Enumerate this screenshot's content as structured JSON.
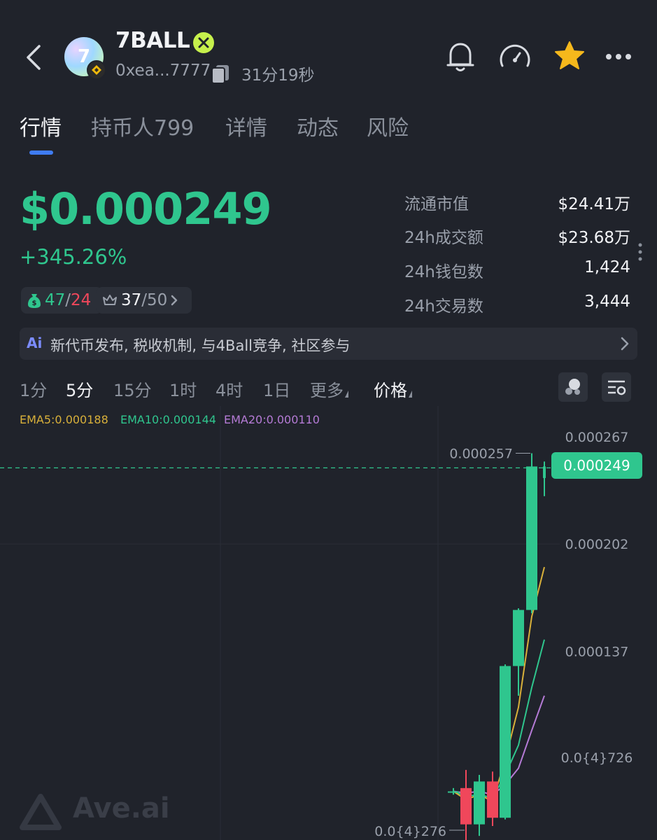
{
  "header": {
    "avatar_letter": "7",
    "token_name": "7BALL",
    "address": "0xea...7777",
    "age": "31分19秒"
  },
  "tabs": [
    {
      "label": "行情"
    },
    {
      "label": "持币人799"
    },
    {
      "label": "详情"
    },
    {
      "label": "动态"
    },
    {
      "label": "风险"
    }
  ],
  "price": {
    "value": "$0.000249",
    "change": "+345.26%"
  },
  "chips": {
    "buys": "47",
    "sep": "/",
    "sells": "24",
    "holders_a": "37",
    "holders_b": "/50"
  },
  "stats": [
    {
      "label": "流通市值",
      "value": "$24.41万"
    },
    {
      "label": "24h成交额",
      "value": "$23.68万"
    },
    {
      "label": "24h钱包数",
      "value": "1,424"
    },
    {
      "label": "24h交易数",
      "value": "3,444"
    }
  ],
  "ai_banner": {
    "icon": "Ai",
    "text": "新代币发布, 税收机制, 与4Ball竞争, 社区参与"
  },
  "timeframes": [
    {
      "label": "1分"
    },
    {
      "label": "5分"
    },
    {
      "label": "15分"
    },
    {
      "label": "1时"
    },
    {
      "label": "4时"
    },
    {
      "label": "1日"
    },
    {
      "label": "更多"
    },
    {
      "label": "价格"
    }
  ],
  "ema": {
    "ema5": "EMA5:0.000188",
    "ema10": "EMA10:0.000144",
    "ema20": "EMA20:0.000110"
  },
  "colors": {
    "up": "#2fc68e",
    "down": "#f0475b",
    "ema5": "#d8b03a",
    "ema10": "#2fc68e",
    "ema20": "#b57bd6"
  },
  "chart_data": {
    "type": "candlestick",
    "y_axis_labels": [
      "0.000267",
      "0.000202",
      "0.000137",
      "0.0{4}726"
    ],
    "high_label": "0.000257",
    "low_label": "0.0{4}276",
    "current_price_label": "0.000249",
    "ylim": [
      3e-05,
      0.00027
    ],
    "candles": [
      {
        "open": 5.2e-05,
        "close": 5.2e-05,
        "high": 5.4e-05,
        "low": 5e-05
      },
      {
        "open": 5.4e-05,
        "close": 3.2e-05,
        "high": 6.5e-05,
        "low": 2e-05
      },
      {
        "open": 3.2e-05,
        "close": 5.8e-05,
        "high": 6.2e-05,
        "low": 2.5e-05
      },
      {
        "open": 5.8e-05,
        "close": 3.6e-05,
        "high": 6.4e-05,
        "low": 3.1e-05
      },
      {
        "open": 3.6e-05,
        "close": 0.000128,
        "high": 0.000129,
        "low": 3.5e-05
      },
      {
        "open": 0.000128,
        "close": 0.000162,
        "high": 0.000163,
        "low": 0.00011
      },
      {
        "open": 0.000162,
        "close": 0.000249,
        "high": 0.000257,
        "low": 0.00016
      },
      {
        "open": 0.000242,
        "close": 0.000249,
        "high": 0.000252,
        "low": 0.000231
      }
    ],
    "ema5": [
      5.2e-05,
      4.7e-05,
      5e-05,
      4.6e-05,
      7.1e-05,
      0.000103,
      0.000158,
      0.000188
    ],
    "ema10": [
      5.2e-05,
      4.9e-05,
      5e-05,
      4.8e-05,
      6.2e-05,
      8e-05,
      0.000115,
      0.000144
    ],
    "ema20": [
      5.2e-05,
      5.1e-05,
      5.2e-05,
      5e-05,
      5.6e-05,
      6.6e-05,
      8.9e-05,
      0.00011
    ]
  },
  "watermark": "Ave.ai"
}
